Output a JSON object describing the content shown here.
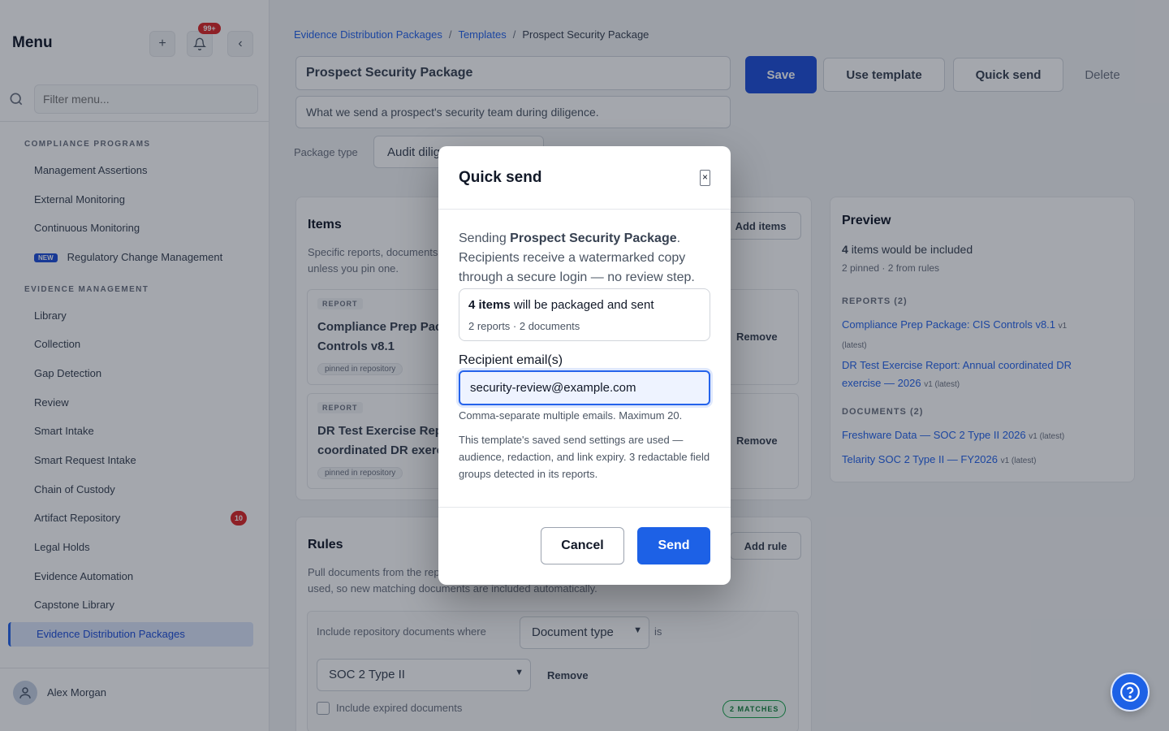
{
  "sidebar": {
    "title": "Menu",
    "notification_badge": "99+",
    "filter_placeholder": "Filter menu...",
    "sections": [
      {
        "label": "COMPLIANCE PROGRAMS"
      },
      {
        "label": "EVIDENCE MANAGEMENT"
      }
    ],
    "compliance_items": [
      "Management Assertions",
      "External Monitoring",
      "Continuous Monitoring",
      "Regulatory Change Management"
    ],
    "new_badge": "NEW",
    "evidence_items": [
      "Library",
      "Collection",
      "Gap Detection",
      "Review",
      "Smart Intake",
      "Smart Request Intake",
      "Chain of Custody",
      "Artifact Repository",
      "Legal Holds",
      "Evidence Automation",
      "Capstone Library",
      "Evidence Distribution Packages"
    ],
    "artifact_count": "10",
    "user_name": "Alex Morgan"
  },
  "breadcrumb": {
    "root": "Evidence Distribution Packages",
    "middle": "Templates",
    "current": "Prospect Security Package"
  },
  "form": {
    "name": "Prospect Security Package",
    "description": "What we send a prospect's security team during diligence.",
    "package_type_label": "Package type",
    "package_type_value": "Audit diligence"
  },
  "toolbar": {
    "save": "Save",
    "use_template": "Use template",
    "quick_send": "Quick send",
    "delete": "Delete"
  },
  "items_card": {
    "title": "Items",
    "subtitle_line1": "Specific reports, documents pinned to this template. Pinned items use the latest version",
    "subtitle_line2": "unless you pin one.",
    "add_button": "Add items",
    "entries": [
      {
        "tag": "REPORT",
        "title_line1": "Compliance Prep Package: CIS",
        "title_line2": "Controls v8.1",
        "pill": "pinned in repository",
        "remove": "Remove"
      },
      {
        "tag": "REPORT",
        "title_line1": "DR Test Exercise Report: Annual",
        "title_line2": "coordinated DR exercise",
        "pill": "pinned in repository",
        "remove": "Remove"
      }
    ]
  },
  "rules_card": {
    "title": "Rules",
    "subtitle_line1": "Pull documents from the repository automatically. Each time this template is",
    "subtitle_line2": "used, so new matching documents are included automatically.",
    "add_button": "Add rule",
    "rule_prefix": "Include repository documents where",
    "field_select": "Document type",
    "operator": "is",
    "value_select": "SOC 2 Type II",
    "remove": "Remove",
    "expired_label": "Include expired documents",
    "matches_badge": "2 MATCHES"
  },
  "preview": {
    "title": "Preview",
    "count_bold": "4",
    "count_text": "items would be included",
    "breakdown": "2 pinned · 2 from rules",
    "reports_header": "REPORTS (2)",
    "reports": [
      {
        "line1": "Compliance Prep Package: CIS Controls v8.1",
        "meta1": "v1",
        "meta2": "(latest)"
      },
      {
        "line1": "DR Test Exercise Report: Annual coordinated DR",
        "line2": "exercise — 2026",
        "meta": "v1 (latest)"
      }
    ],
    "documents_header": "DOCUMENTS (2)",
    "documents": [
      {
        "line": "Freshware Data — SOC 2 Type II 2026",
        "meta": "v1 (latest)"
      },
      {
        "line": "Telarity SOC 2 Type II — FY2026",
        "meta": "v1 (latest)"
      }
    ]
  },
  "modal": {
    "title": "Quick send",
    "close_glyph": "×",
    "intro_prefix": "Sending ",
    "intro_package": "Prospect Security Package",
    "intro_suffix": ". Recipients receive a watermarked copy through a secure login — no review step.",
    "summary_count": "4 items",
    "summary_text": " will be packaged and sent",
    "summary_breakdown": "2 reports · 2 documents",
    "email_label": "Recipient email(s)",
    "email_value": "security-review@example.com",
    "email_help": "Comma-separate multiple emails. Maximum 20.",
    "settings_note": "This template's saved send settings are used — audience, redaction, and link expiry. 3 redactable field groups detected in its reports.",
    "cancel": "Cancel",
    "send": "Send"
  },
  "help_icon": "question-circle-icon",
  "colors": {
    "primary": "#1d61e6",
    "danger": "#dc2626",
    "success": "#16a34a",
    "overlay": "rgba(17, 24, 39, 0.38)"
  }
}
